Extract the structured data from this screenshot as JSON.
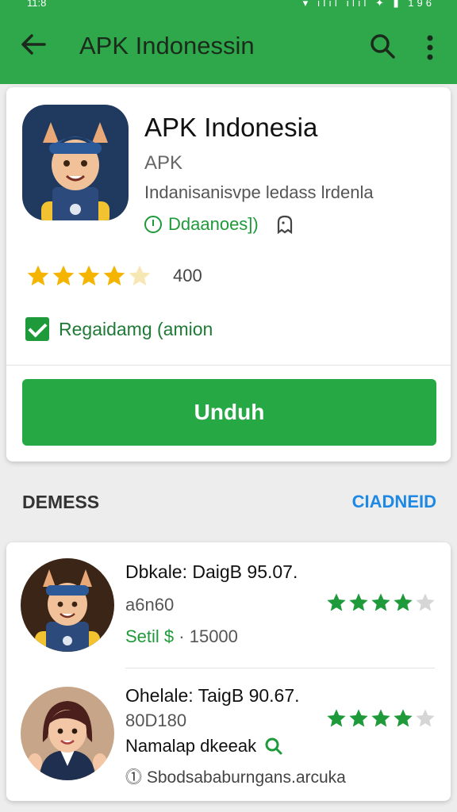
{
  "status_bar": {
    "time": "11:8",
    "right": "196"
  },
  "app_bar": {
    "title": "APK Indonessin",
    "back_icon": "arrow-left-icon",
    "search_icon": "search-icon",
    "more_icon": "more-vert-icon",
    "color": "#2ea84a"
  },
  "app": {
    "name": "APK Indonesia",
    "type": "APK",
    "description": "Indanisanisvpe ledass lrdenla",
    "downloads_label": "Ddaanoes])",
    "rating_stars": 4.5,
    "rating_value": "400",
    "checkbox_label": "Regaidamg (amion",
    "checkbox_checked": true,
    "download_button": "Unduh"
  },
  "section": {
    "title": "DEMESS",
    "link": "CIADNEID"
  },
  "list": [
    {
      "title": "Dbkale: DaigB  95.07.",
      "subtitle": "a6n60",
      "meta_label": "Setil $",
      "meta_value": "· 15000",
      "stars": 4
    },
    {
      "title": "Ohelale: TaigB  90.67.",
      "subtitle": "80D180",
      "line3": "Namalap dkeeak",
      "line4": "⓵ Sbodsababurngans.arcuka",
      "stars": 4
    }
  ],
  "colors": {
    "accent": "#26a845",
    "star": "#f5b400",
    "link": "#1e88e5"
  }
}
